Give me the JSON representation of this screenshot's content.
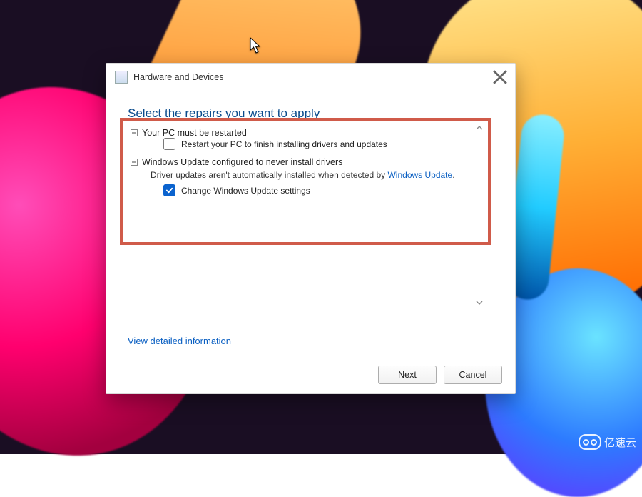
{
  "dialog": {
    "title": "Hardware and Devices",
    "heading": "Select the repairs you want to apply",
    "items": [
      {
        "title": "Your PC must be restarted",
        "desc": "",
        "action_label": "Restart your PC to finish installing drivers and updates",
        "checked": false
      },
      {
        "title": "Windows Update configured to never install drivers",
        "desc_pre": "Driver updates aren't automatically installed when detected by ",
        "desc_link": "Windows Update",
        "desc_post": ".",
        "action_label": "Change Windows Update settings",
        "checked": true
      }
    ],
    "detail_link": "View detailed information",
    "buttons": {
      "next": "Next",
      "cancel": "Cancel"
    }
  },
  "watermark": "亿速云"
}
